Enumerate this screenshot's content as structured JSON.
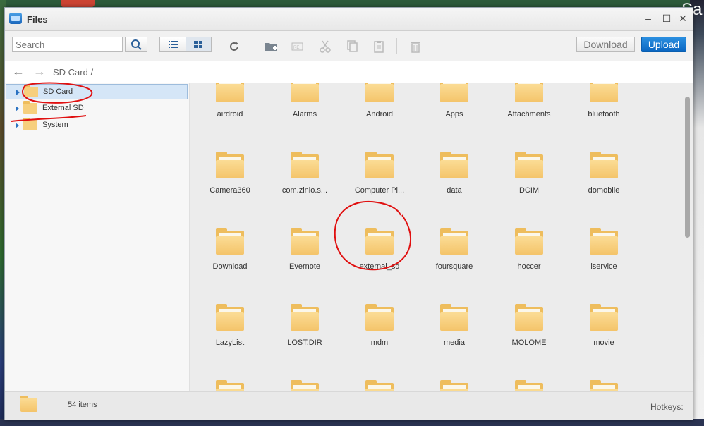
{
  "window": {
    "title": "Files"
  },
  "toolbar": {
    "search_placeholder": "Search",
    "download_label": "Download",
    "upload_label": "Upload"
  },
  "path": {
    "crumb": "SD Card",
    "separator": "/"
  },
  "tree": {
    "items": [
      {
        "label": "SD Card",
        "selected": true
      },
      {
        "label": "External SD",
        "selected": false
      },
      {
        "label": "System",
        "selected": false
      }
    ]
  },
  "files": [
    "airdroid",
    "Alarms",
    "Android",
    "Apps",
    "Attachments",
    "bluetooth",
    "Camera360",
    "com.zinio.s...",
    "Computer Pl...",
    "data",
    "DCIM",
    "domobile",
    "Download",
    "Evernote",
    "external_sd",
    "foursquare",
    "hoccer",
    "iservice",
    "LazyList",
    "LOST.DIR",
    "mdm",
    "media",
    "MOLOME",
    "movie",
    "",
    "",
    "",
    "",
    "",
    ""
  ],
  "status": {
    "count": "54 items",
    "hotkeys_label": "Hotkeys:"
  },
  "desktop": {
    "side_text": "Sa"
  },
  "colors": {
    "accent": "#0a66c2",
    "folder": "#f4c46a",
    "annotation": "#e01010",
    "selection": "#d5e6f7"
  }
}
